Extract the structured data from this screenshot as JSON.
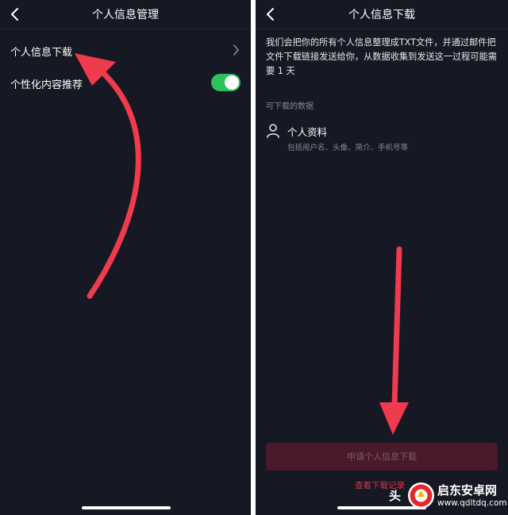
{
  "left_screen": {
    "title": "个人信息管理",
    "rows": [
      {
        "label": "个人信息下载",
        "control": "chevron-right"
      },
      {
        "label": "个性化内容推荐",
        "control": "toggle",
        "toggle_on": true
      }
    ]
  },
  "right_screen": {
    "title": "个人信息下载",
    "description": "我们会把你的所有个人信息整理成TXT文件，并通过邮件把文件下载链接发送给你，从数据收集到发送这一过程可能需要 1 天",
    "section_label": "可下载的数据",
    "item": {
      "title": "个人资料",
      "subtitle": "包括用户名、头像、简介、手机号等"
    },
    "apply_button": "申请个人信息下载",
    "records_link": "查看下载记录"
  },
  "annotations": {
    "arrow_color": "#f03a4e"
  },
  "watermark": {
    "head_char": "头",
    "site_name": "启东安卓网",
    "site_url": "www.qdltdq.com"
  },
  "colors": {
    "background": "#161823",
    "toggle_on": "#2dc15c",
    "accent": "#d8354e"
  }
}
